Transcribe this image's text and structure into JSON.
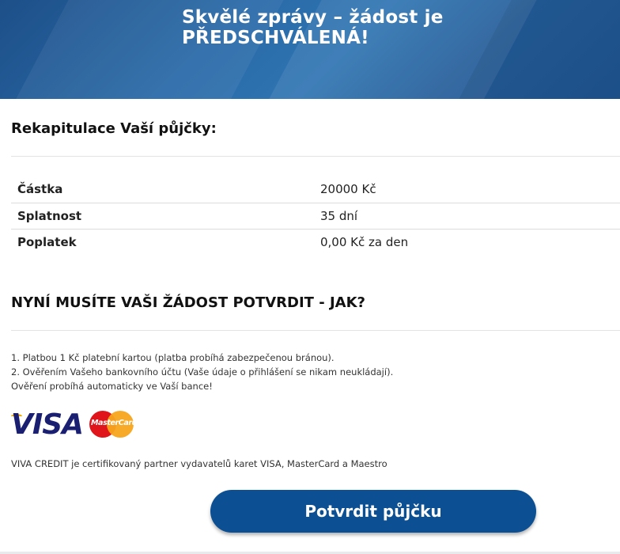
{
  "hero": {
    "title": "Skvělé zprávy – žádost je PŘEDSCHVÁLENÁ!"
  },
  "summary": {
    "title": "Rekapitulace Vaší půjčky:",
    "rows": [
      {
        "label": "Částka",
        "value": "20000 Kč"
      },
      {
        "label": "Splatnost",
        "value": "35 dní"
      },
      {
        "label": "Poplatek",
        "value": "0,00 Kč za den"
      }
    ]
  },
  "confirm": {
    "title": "NYNÍ MUSÍTE VAŠI ŽÁDOST POTVRDIT - JAK?",
    "steps": [
      "1. Platbou 1 Kč platební kartou (platba probíhá zabezpečenou bránou).",
      "2. Ověřením Vašeho bankovního účtu (Vaše údaje o přihlášení se nikam neukládají).",
      "Ověření probíhá automaticky ve Vaší bance!"
    ],
    "logos": {
      "visa": "VISA",
      "mastercard": "MasterCard"
    },
    "partner_text": "VIVA CREDIT je certifikovaný partner vydavatelů karet VISA, MasterCard a Maestro",
    "button_label": "Potvrdit půjčku"
  },
  "colors": {
    "hero_blue": "#2a6aa8",
    "button_blue": "#0c4f92",
    "visa_blue": "#1a1f71",
    "mc_red": "#e0151b",
    "mc_orange": "#f7a51c"
  }
}
